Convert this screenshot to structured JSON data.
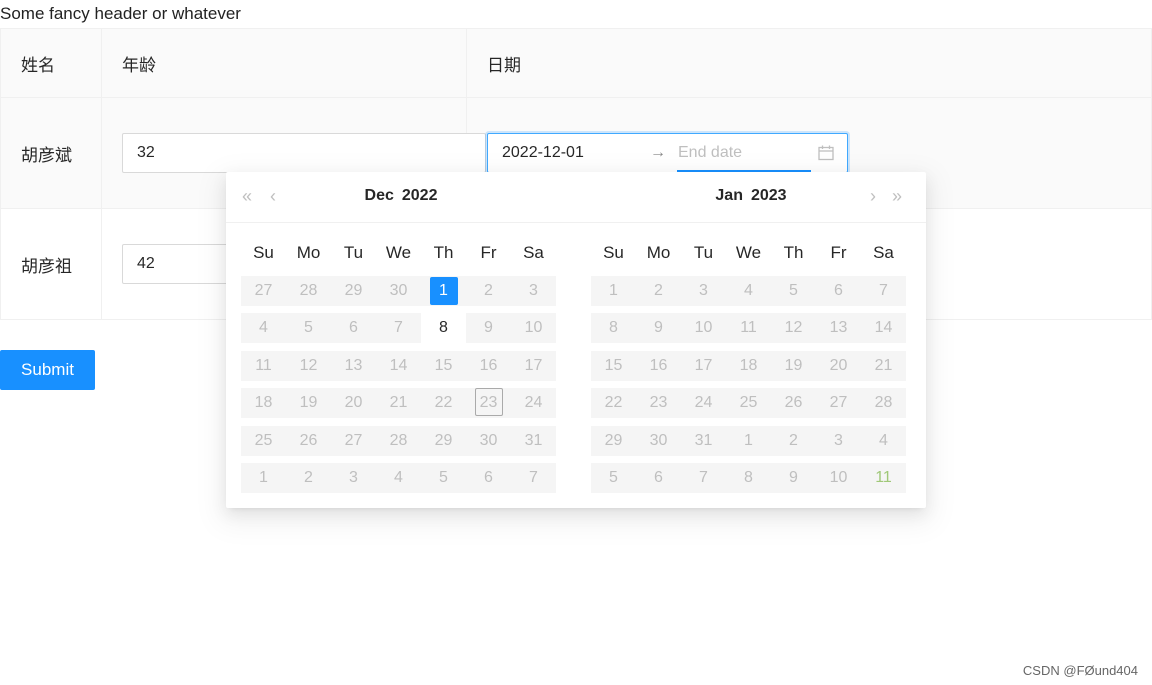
{
  "header": {
    "text": "Some fancy header or whatever"
  },
  "table": {
    "columns": [
      "姓名",
      "年龄",
      "日期"
    ],
    "rows": [
      {
        "name": "胡彦斌",
        "age": "32",
        "date_start": "2022-12-01",
        "date_end_placeholder": "End date"
      },
      {
        "name": "胡彦祖",
        "age": "42"
      }
    ]
  },
  "range_separator": "→",
  "submit": {
    "label": "Submit"
  },
  "calendar": {
    "weekdays": [
      "Su",
      "Mo",
      "Tu",
      "We",
      "Th",
      "Fr",
      "Sa"
    ],
    "nav": {
      "super_prev": "«",
      "prev": "‹",
      "next": "›",
      "super_next": "»"
    },
    "left": {
      "month": "Dec",
      "year": "2022",
      "weeks": [
        [
          "27",
          "28",
          "29",
          "30",
          "1",
          "2",
          "3"
        ],
        [
          "4",
          "5",
          "6",
          "7",
          "8",
          "9",
          "10"
        ],
        [
          "11",
          "12",
          "13",
          "14",
          "15",
          "16",
          "17"
        ],
        [
          "18",
          "19",
          "20",
          "21",
          "22",
          "23",
          "24"
        ],
        [
          "25",
          "26",
          "27",
          "28",
          "29",
          "30",
          "31"
        ],
        [
          "1",
          "2",
          "3",
          "4",
          "5",
          "6",
          "7"
        ]
      ]
    },
    "right": {
      "month": "Jan",
      "year": "2023",
      "weeks": [
        [
          "1",
          "2",
          "3",
          "4",
          "5",
          "6",
          "7"
        ],
        [
          "8",
          "9",
          "10",
          "11",
          "12",
          "13",
          "14"
        ],
        [
          "15",
          "16",
          "17",
          "18",
          "19",
          "20",
          "21"
        ],
        [
          "22",
          "23",
          "24",
          "25",
          "26",
          "27",
          "28"
        ],
        [
          "29",
          "30",
          "31",
          "1",
          "2",
          "3",
          "4"
        ],
        [
          "5",
          "6",
          "7",
          "8",
          "9",
          "10",
          "11"
        ]
      ]
    },
    "selected_date": "2022-12-01",
    "today_date": "2022-12-23",
    "enabled_dates": [
      "2022-12-08"
    ]
  },
  "watermark": "CSDN @FØund404"
}
